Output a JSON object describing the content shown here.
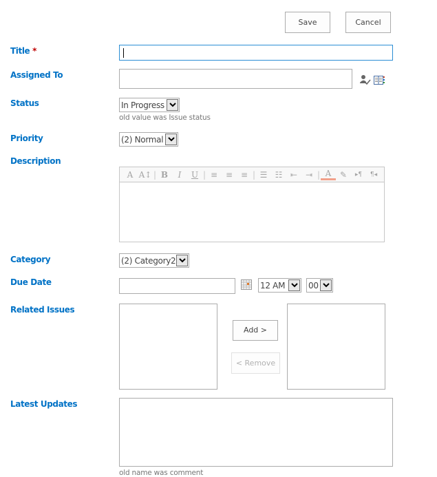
{
  "toolbar": {
    "save_label": "Save",
    "cancel_label": "Cancel"
  },
  "fields": {
    "title": {
      "label": "Title",
      "required_mark": "*",
      "value": ""
    },
    "assigned_to": {
      "label": "Assigned To",
      "value": "",
      "icons": [
        "check-names-icon",
        "browse-directory-icon"
      ]
    },
    "status": {
      "label": "Status",
      "selected": "In Progress",
      "hint": "old value was Issue status"
    },
    "priority": {
      "label": "Priority",
      "selected": "(2) Normal"
    },
    "description": {
      "label": "Description",
      "toolbar_icons": [
        "font-icon",
        "font-size-icon",
        "bold-icon",
        "italic-icon",
        "underline-icon",
        "align-left-icon",
        "align-center-icon",
        "align-right-icon",
        "numbered-list-icon",
        "bulleted-list-icon",
        "decrease-indent-icon",
        "increase-indent-icon",
        "text-color-icon",
        "highlight-color-icon",
        "ltr-icon",
        "rtl-icon"
      ],
      "value": ""
    },
    "category": {
      "label": "Category",
      "selected": "(2) Category2"
    },
    "due_date": {
      "label": "Due Date",
      "value": "",
      "hour": "12 AM",
      "minute": "00"
    },
    "related_issues": {
      "label": "Related Issues",
      "add_label": "Add >",
      "remove_label": "< Remove"
    },
    "latest_updates": {
      "label": "Latest Updates",
      "value": "",
      "hint": "old name was comment"
    }
  },
  "colors": {
    "label": "#0072c6",
    "required": "#bf0000",
    "focus_border": "#2a8dd4"
  }
}
